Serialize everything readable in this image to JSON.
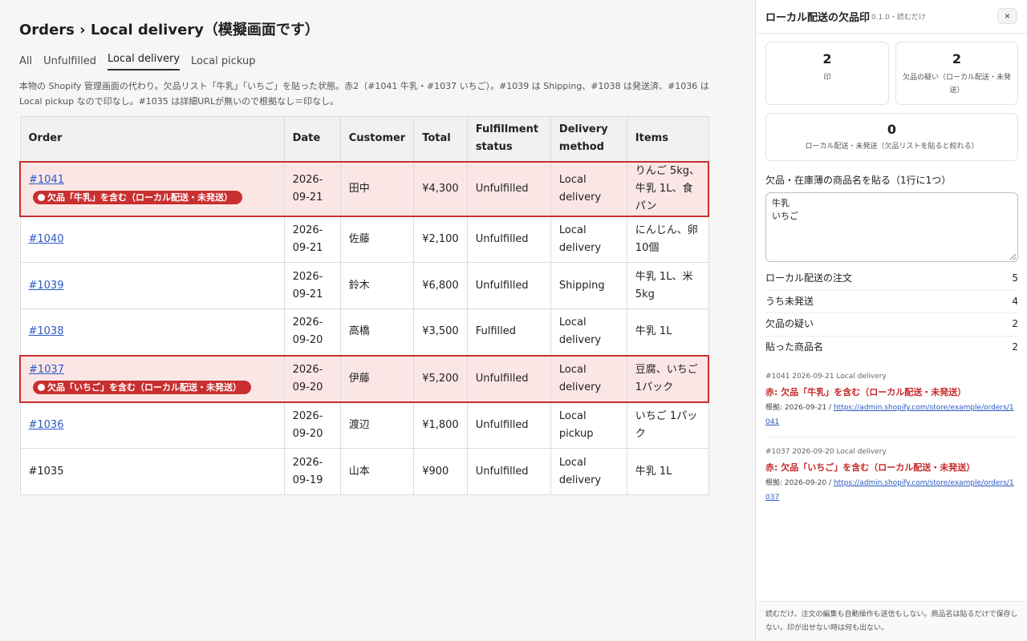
{
  "page": {
    "title": "Orders › Local delivery（模擬画面です）",
    "tabs": [
      "All",
      "Unfulfilled",
      "Local delivery",
      "Local pickup"
    ],
    "active_tab": "Local delivery",
    "notice": "本物の Shopify 管理画面の代わり。欠品リスト「牛乳」「いちご」を貼った状態。赤2（#1041 牛乳・#1037 いちご）。#1039 は Shipping、#1038 は発送済、#1036 は Local pickup なので印なし。#1035 は詳細URLが無いので根拠なし＝印なし。"
  },
  "table": {
    "headers": [
      "Order",
      "Date",
      "Customer",
      "Total",
      "Fulfillment status",
      "Delivery method",
      "Items"
    ],
    "rows": [
      {
        "order": "#1041",
        "link": true,
        "flag": "欠品「牛乳」を含む（ローカル配送・未発送）",
        "date": "2026-09-21",
        "customer": "田中",
        "total": "¥4,300",
        "status": "Unfulfilled",
        "delivery": "Local delivery",
        "items": "りんご 5kg、牛乳 1L、食パン"
      },
      {
        "order": "#1040",
        "link": true,
        "flag": "",
        "date": "2026-09-21",
        "customer": "佐藤",
        "total": "¥2,100",
        "status": "Unfulfilled",
        "delivery": "Local delivery",
        "items": "にんじん、卵 10個"
      },
      {
        "order": "#1039",
        "link": true,
        "flag": "",
        "date": "2026-09-21",
        "customer": "鈴木",
        "total": "¥6,800",
        "status": "Unfulfilled",
        "delivery": "Shipping",
        "items": "牛乳 1L、米 5kg"
      },
      {
        "order": "#1038",
        "link": true,
        "flag": "",
        "date": "2026-09-20",
        "customer": "高橋",
        "total": "¥3,500",
        "status": "Fulfilled",
        "delivery": "Local delivery",
        "items": "牛乳 1L"
      },
      {
        "order": "#1037",
        "link": true,
        "flag": "欠品「いちご」を含む（ローカル配送・未発送）",
        "date": "2026-09-20",
        "customer": "伊藤",
        "total": "¥5,200",
        "status": "Unfulfilled",
        "delivery": "Local delivery",
        "items": "豆腐、いちご 1パック"
      },
      {
        "order": "#1036",
        "link": true,
        "flag": "",
        "date": "2026-09-20",
        "customer": "渡辺",
        "total": "¥1,800",
        "status": "Unfulfilled",
        "delivery": "Local pickup",
        "items": "いちご 1パック"
      },
      {
        "order": "#1035",
        "link": false,
        "flag": "",
        "date": "2026-09-19",
        "customer": "山本",
        "total": "¥900",
        "status": "Unfulfilled",
        "delivery": "Local delivery",
        "items": "牛乳 1L"
      }
    ]
  },
  "panel": {
    "title": "ローカル配送の欠品印",
    "meta": "0.1.0・読むだけ",
    "close_label": "×",
    "cards": [
      {
        "value": "2",
        "label": "印"
      },
      {
        "value": "2",
        "label": "欠品の疑い（ローカル配送・未発送）"
      },
      {
        "value": "0",
        "label": "ローカル配送・未発送（欠品リストを貼ると絞れる）"
      }
    ],
    "paste_label": "欠品・在庫薄の商品名を貼る（1行に1つ）",
    "paste_value": "牛乳\nいちご",
    "stats": [
      {
        "label": "ローカル配送の注文",
        "value": "5"
      },
      {
        "label": "うち未発送",
        "value": "4"
      },
      {
        "label": "欠品の疑い",
        "value": "2"
      },
      {
        "label": "貼った商品名",
        "value": "2"
      }
    ],
    "findings": [
      {
        "meta": "#1041 2026-09-21 Local delivery",
        "title": "赤: 欠品「牛乳」を含む（ローカル配送・未発送）",
        "evidence_prefix": "根拠: 2026-09-21 / ",
        "url": "https://admin.shopify.com/store/example/orders/1041"
      },
      {
        "meta": "#1037 2026-09-20 Local delivery",
        "title": "赤: 欠品「いちご」を含む（ローカル配送・未発送）",
        "evidence_prefix": "根拠: 2026-09-20 / ",
        "url": "https://admin.shopify.com/store/example/orders/1037"
      }
    ],
    "footer": "読むだけ。注文の編集も自動操作も送信もしない。商品名は貼るだけで保存しない。印が出せない時は何も出ない。"
  }
}
